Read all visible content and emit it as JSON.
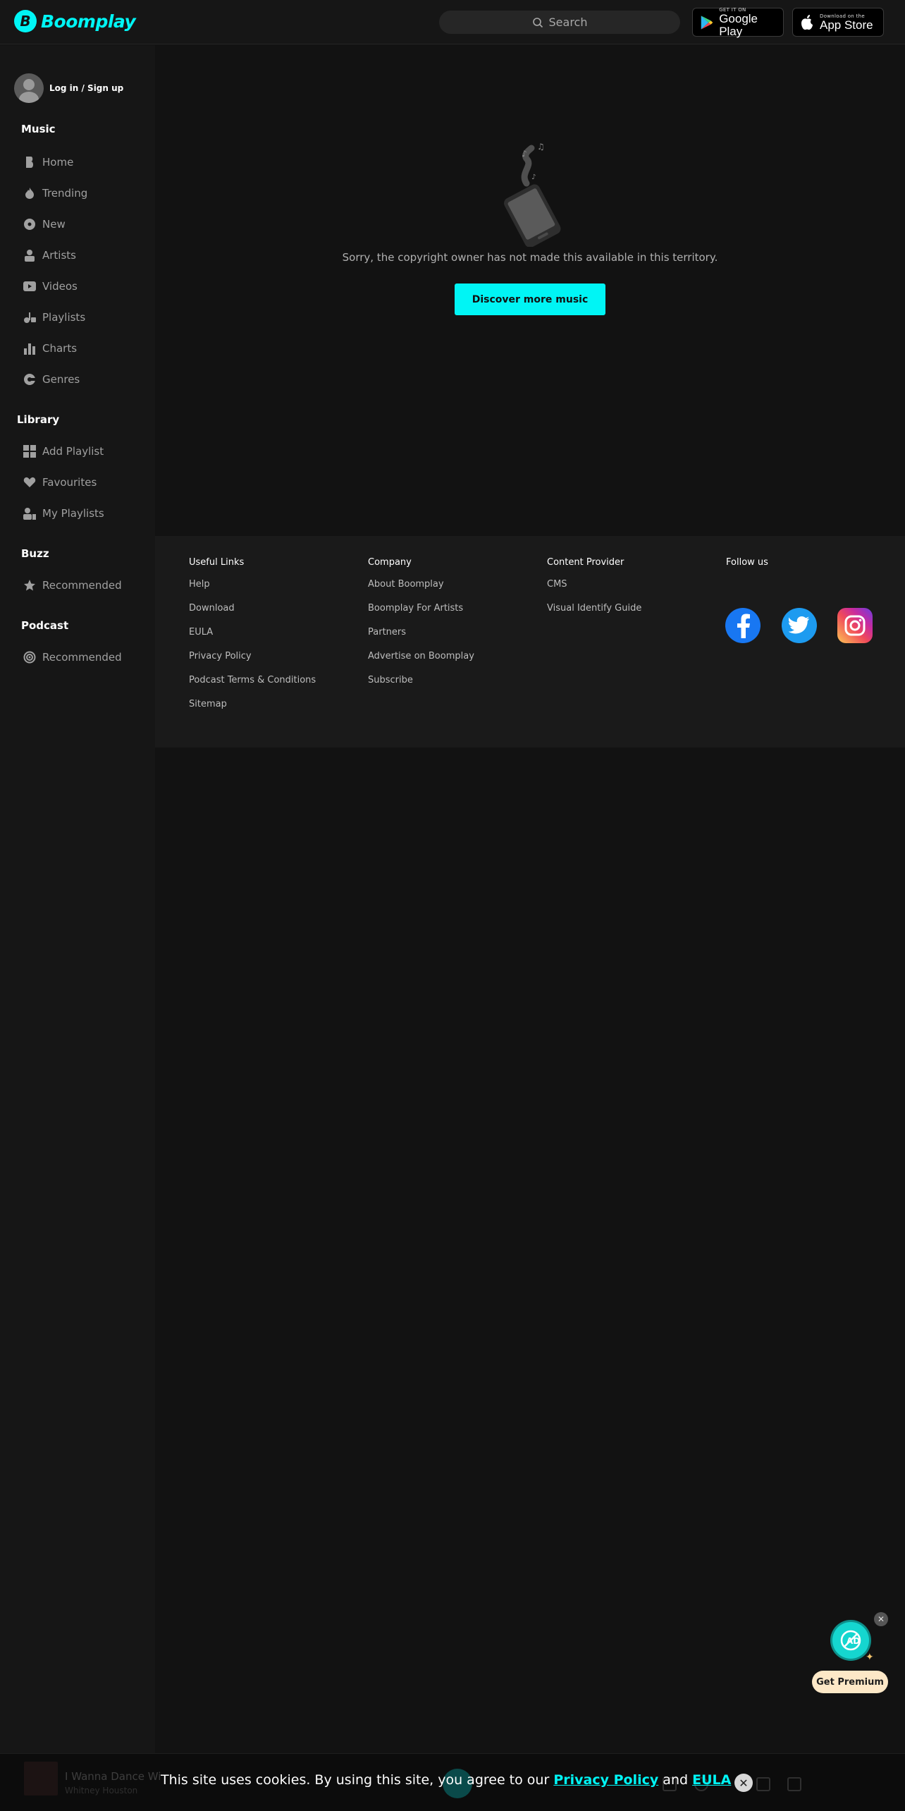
{
  "header": {
    "logo_letter": "B",
    "logo_text": "Boomplay",
    "search_placeholder": "Search",
    "google_play": {
      "small": "GET IT ON",
      "big": "Google Play"
    },
    "app_store": {
      "small": "Download on the",
      "big": "App Store"
    }
  },
  "sidebar": {
    "login": "Log in /  Sign up",
    "sections": {
      "music": "Music",
      "library": "Library",
      "buzz": "Buzz",
      "podcast": "Podcast"
    },
    "music_items": [
      "Home",
      "Trending",
      "New",
      "Artists",
      "Videos",
      "Playlists",
      "Charts",
      "Genres"
    ],
    "library_items": [
      "Add Playlist",
      "Favourites",
      "My Playlists"
    ],
    "buzz_items": [
      "Recommended"
    ],
    "podcast_items": [
      "Recommended"
    ]
  },
  "content": {
    "notice": "Sorry, the copyright owner has not made this available in this territory.",
    "discover_button": "Discover more music"
  },
  "footer": {
    "useful_links": {
      "title": "Useful Links",
      "items": [
        "Help",
        "Download",
        "EULA",
        "Privacy Policy",
        "Podcast Terms & Conditions",
        "Sitemap"
      ]
    },
    "company": {
      "title": "Company",
      "items": [
        "About Boomplay",
        "Boomplay For Artists",
        "Partners",
        "Advertise on Boomplay",
        "Subscribe"
      ]
    },
    "content_provider": {
      "title": "Content Provider",
      "items": [
        "CMS",
        "Visual Identify Guide"
      ]
    },
    "follow_us": {
      "title": "Follow us"
    }
  },
  "premium": {
    "button": "Get Premium"
  },
  "player": {
    "track": "I Wanna Dance Wi",
    "artist": "Whitney Houston"
  },
  "cookie": {
    "text_before": "This site uses cookies. By using this site, you agree to our ",
    "privacy_link": "Privacy Policy",
    "and": " and ",
    "eula_link": "EULA"
  },
  "colors": {
    "accent": "#00f5f5",
    "background": "#121212",
    "sidebar": "#161616"
  }
}
